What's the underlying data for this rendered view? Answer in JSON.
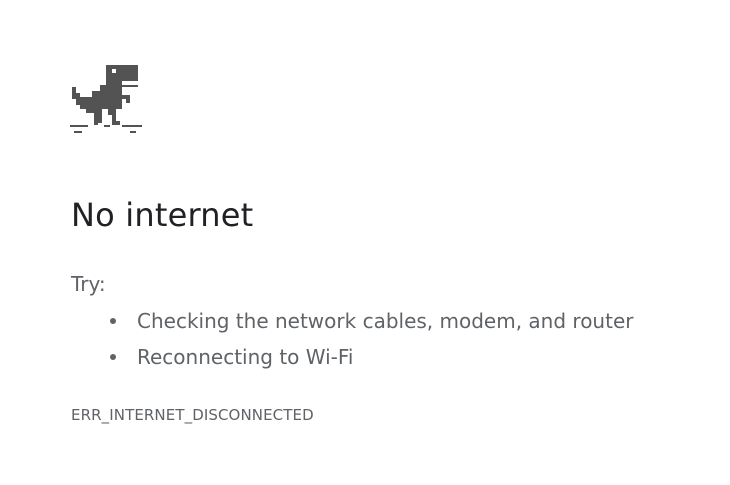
{
  "icon": "offline-dino-icon",
  "title": "No internet",
  "suggestions": {
    "label": "Try:",
    "items": [
      "Checking the network cables, modem, and router",
      "Reconnecting to Wi-Fi"
    ]
  },
  "error_code": "ERR_INTERNET_DISCONNECTED",
  "colors": {
    "title": "#202124",
    "body_text": "#5f6368",
    "dino": "#535353",
    "background": "#ffffff"
  }
}
